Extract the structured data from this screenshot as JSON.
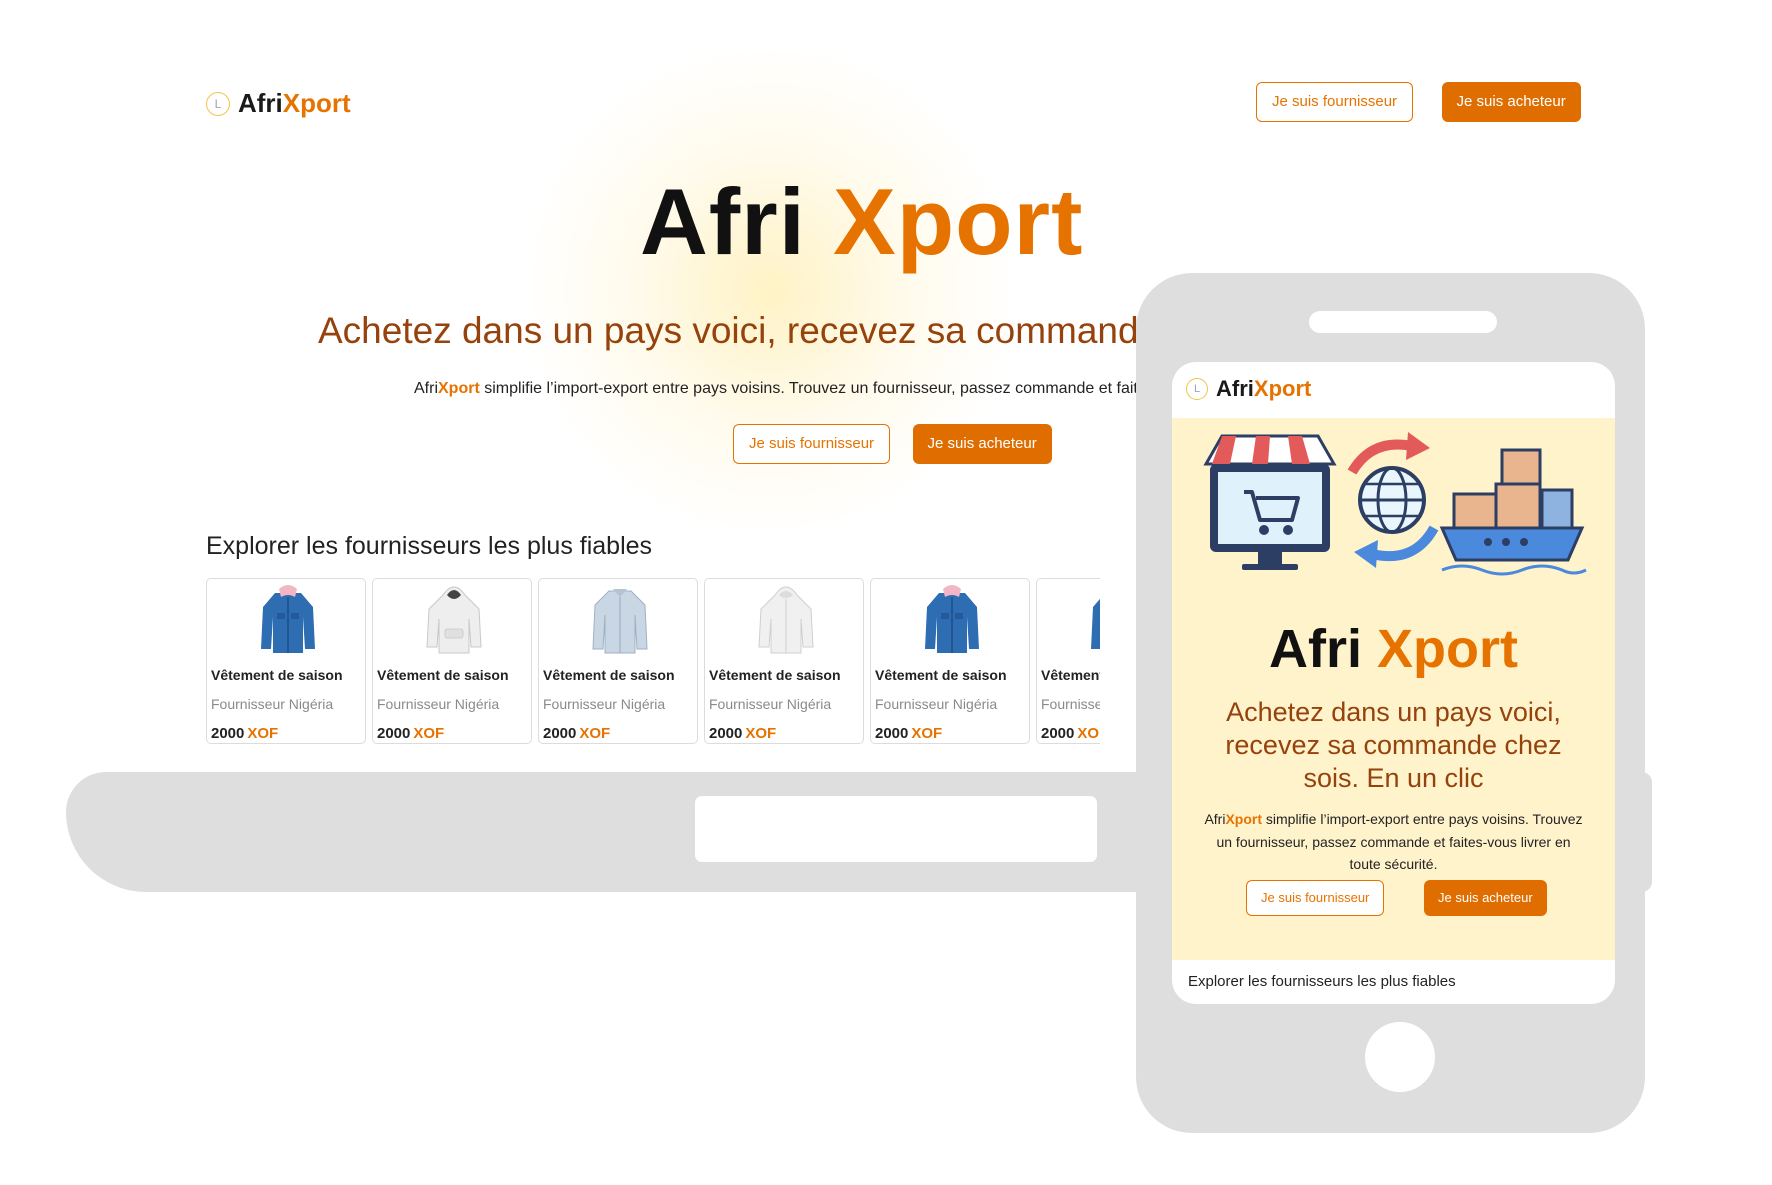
{
  "brand": {
    "prefix": "Afri",
    "accent": "Xport"
  },
  "header": {
    "supplier_button": "Je suis fournisseur",
    "buyer_button": "Je suis acheteur"
  },
  "hero": {
    "title_prefix": "Afri",
    "title_accent": "Xport",
    "subtitle": "Achetez dans un pays voici, recevez sa commande chez soi. En un clic",
    "desc_brand_prefix": "Afri",
    "desc_brand_accent": "Xport",
    "desc": " simplifie l’import-export entre pays voisins. Trouvez un fournisseur, passez commande et faites-vous livrer en toute sécurité.",
    "supplier_button": "Je suis fournisseur",
    "buyer_button": "Je suis acheteur"
  },
  "suppliers_section": {
    "title": "Explorer les fournisseurs les plus fiables",
    "products": [
      {
        "name": "Vêtement de saison",
        "supplier": "Fournisseur Nigéria",
        "price": "2000",
        "currency": "XOF",
        "image": "denim-jacket-icon"
      },
      {
        "name": "Vêtement de saison",
        "supplier": "Fournisseur Nigéria",
        "price": "2000",
        "currency": "XOF",
        "image": "white-hoodie-icon"
      },
      {
        "name": "Vêtement de saison",
        "supplier": "Fournisseur Nigéria",
        "price": "2000",
        "currency": "XOF",
        "image": "shirt-icon"
      },
      {
        "name": "Vêtement de saison",
        "supplier": "Fournisseur Nigéria",
        "price": "2000",
        "currency": "XOF",
        "image": "grey-hoodie-icon"
      },
      {
        "name": "Vêtement de saison",
        "supplier": "Fournisseur Nigéria",
        "price": "2000",
        "currency": "XOF",
        "image": "denim-jacket-icon"
      },
      {
        "name": "Vêtement de saison",
        "supplier": "Fournisseur Nigéria",
        "price": "2000",
        "currency": "XOF",
        "image": "denim-jacket-icon"
      }
    ]
  },
  "mobile": {
    "brand_prefix": "Afri",
    "brand_accent": "Xport",
    "title_prefix": "Afri",
    "title_accent": "Xport",
    "subtitle": "Achetez dans un pays voici, recevez sa commande chez sois. En un clic",
    "desc_brand_prefix": "Afri",
    "desc_brand_accent": "Xport",
    "desc": " simplifie l’import-export entre pays voisins. Trouvez un fournisseur, passez commande et faites-vous livrer en toute sécurité.",
    "supplier_button": "Je suis fournisseur",
    "buyer_button": "Je suis acheteur",
    "section_title": "Explorer les fournisseurs les plus fiables"
  },
  "colors": {
    "accent": "#e67300",
    "subtitle": "#96420c",
    "mobile_hero_bg": "#fff3cc",
    "device_frame": "#dedede"
  }
}
